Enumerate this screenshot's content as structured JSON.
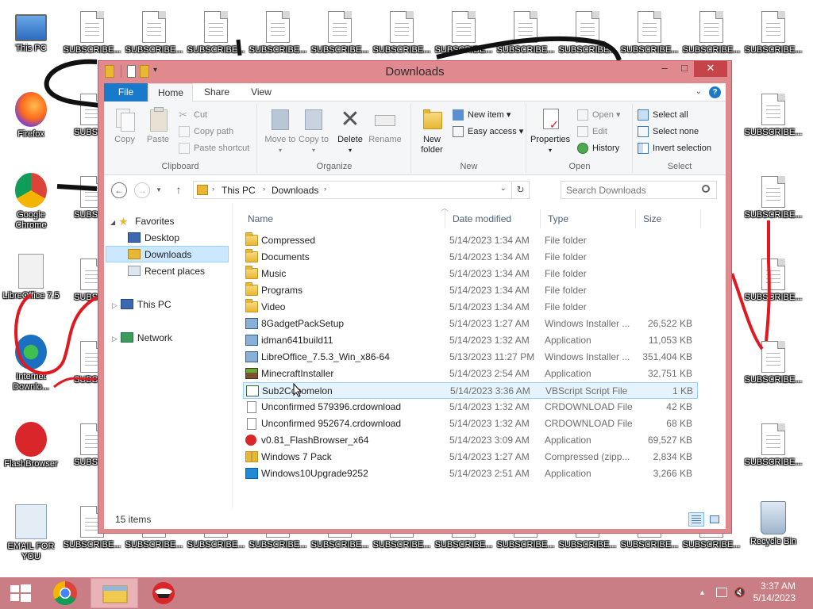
{
  "desktop": {
    "left_icons": [
      {
        "label": "This PC",
        "icon": "this-pc-icon"
      },
      {
        "label": "Firefox",
        "icon": "firefox-icon"
      },
      {
        "label": "Google Chrome",
        "icon": "chrome-icon"
      },
      {
        "label": "LibreOffice 7.5",
        "icon": "libreoffice-icon"
      },
      {
        "label": "Internet Downlo...",
        "icon": "internet-download-manager-icon"
      },
      {
        "label": "FlashBrowser",
        "icon": "flashbrowser-icon"
      },
      {
        "label": "EMAIL FOR YOU",
        "icon": "email-settings-icon"
      }
    ],
    "subscribe_label": "SUBSCRIBE...",
    "subscribe_partial_label": "SUBSCR",
    "recycle_bin_label": "Recycle Bin"
  },
  "window": {
    "title": "Downloads",
    "controls": {
      "minimize": "–",
      "maximize": "□",
      "close": "✕"
    }
  },
  "ribbon": {
    "tabs": [
      "File",
      "Home",
      "Share",
      "View"
    ],
    "clipboard": {
      "group": "Clipboard",
      "copy": "Copy",
      "paste": "Paste",
      "cut": "Cut",
      "copy_path": "Copy path",
      "paste_shortcut": "Paste shortcut"
    },
    "organize": {
      "group": "Organize",
      "move_to": "Move to",
      "copy_to": "Copy to",
      "delete": "Delete",
      "rename": "Rename"
    },
    "new": {
      "group": "New",
      "new_folder": "New folder",
      "new_item": "New item",
      "easy_access": "Easy access"
    },
    "open": {
      "group": "Open",
      "properties": "Properties",
      "open": "Open",
      "edit": "Edit",
      "history": "History"
    },
    "select": {
      "group": "Select",
      "select_all": "Select all",
      "select_none": "Select none",
      "invert_selection": "Invert selection"
    }
  },
  "address": {
    "path": [
      "This PC",
      "Downloads"
    ],
    "search_placeholder": "Search Downloads"
  },
  "navpane": {
    "favorites": "Favorites",
    "desktop": "Desktop",
    "downloads": "Downloads",
    "recent_places": "Recent places",
    "this_pc": "This PC",
    "network": "Network"
  },
  "columns": {
    "name": "Name",
    "date": "Date modified",
    "type": "Type",
    "size": "Size"
  },
  "files": [
    {
      "name": "Compressed",
      "date": "5/14/2023 1:34 AM",
      "type": "File folder",
      "size": "",
      "icon": "folder"
    },
    {
      "name": "Documents",
      "date": "5/14/2023 1:34 AM",
      "type": "File folder",
      "size": "",
      "icon": "folder"
    },
    {
      "name": "Music",
      "date": "5/14/2023 1:34 AM",
      "type": "File folder",
      "size": "",
      "icon": "folder"
    },
    {
      "name": "Programs",
      "date": "5/14/2023 1:34 AM",
      "type": "File folder",
      "size": "",
      "icon": "folder"
    },
    {
      "name": "Video",
      "date": "5/14/2023 1:34 AM",
      "type": "File folder",
      "size": "",
      "icon": "folder"
    },
    {
      "name": "8GadgetPackSetup",
      "date": "5/14/2023 1:27 AM",
      "type": "Windows Installer ...",
      "size": "26,522 KB",
      "icon": "installer"
    },
    {
      "name": "idman641build11",
      "date": "5/14/2023 1:32 AM",
      "type": "Application",
      "size": "11,053 KB",
      "icon": "installer"
    },
    {
      "name": "LibreOffice_7.5.3_Win_x86-64",
      "date": "5/13/2023 11:27 PM",
      "type": "Windows Installer ...",
      "size": "351,404 KB",
      "icon": "installer"
    },
    {
      "name": "MinecraftInstaller",
      "date": "5/14/2023 2:54 AM",
      "type": "Application",
      "size": "32,751 KB",
      "icon": "mc"
    },
    {
      "name": "Sub2Cocomelon",
      "date": "5/14/2023 3:36 AM",
      "type": "VBScript Script File",
      "size": "1 KB",
      "icon": "vbs"
    },
    {
      "name": "Unconfirmed 579396.crdownload",
      "date": "5/14/2023 1:32 AM",
      "type": "CRDOWNLOAD File",
      "size": "42 KB",
      "icon": "filedoc"
    },
    {
      "name": "Unconfirmed 952674.crdownload",
      "date": "5/14/2023 1:32 AM",
      "type": "CRDOWNLOAD File",
      "size": "68 KB",
      "icon": "filedoc"
    },
    {
      "name": "v0.81_FlashBrowser_x64",
      "date": "5/14/2023 3:09 AM",
      "type": "Application",
      "size": "69,527 KB",
      "icon": "flash"
    },
    {
      "name": "Windows 7 Pack",
      "date": "5/14/2023 1:27 AM",
      "type": "Compressed (zipp...",
      "size": "2,834 KB",
      "icon": "zip"
    },
    {
      "name": "Windows10Upgrade9252",
      "date": "5/14/2023 2:51 AM",
      "type": "Application",
      "size": "3,266 KB",
      "icon": "win10"
    }
  ],
  "selected_file": "Sub2Cocomelon",
  "status": {
    "items_count": "15 items"
  },
  "taskbar": {
    "time": "3:37 AM",
    "date": "5/14/2023"
  },
  "colors": {
    "window_frame": "#e08a90",
    "taskbar": "#c87e84",
    "file_tab": "#1979ca",
    "selection": "#cce8ff"
  }
}
